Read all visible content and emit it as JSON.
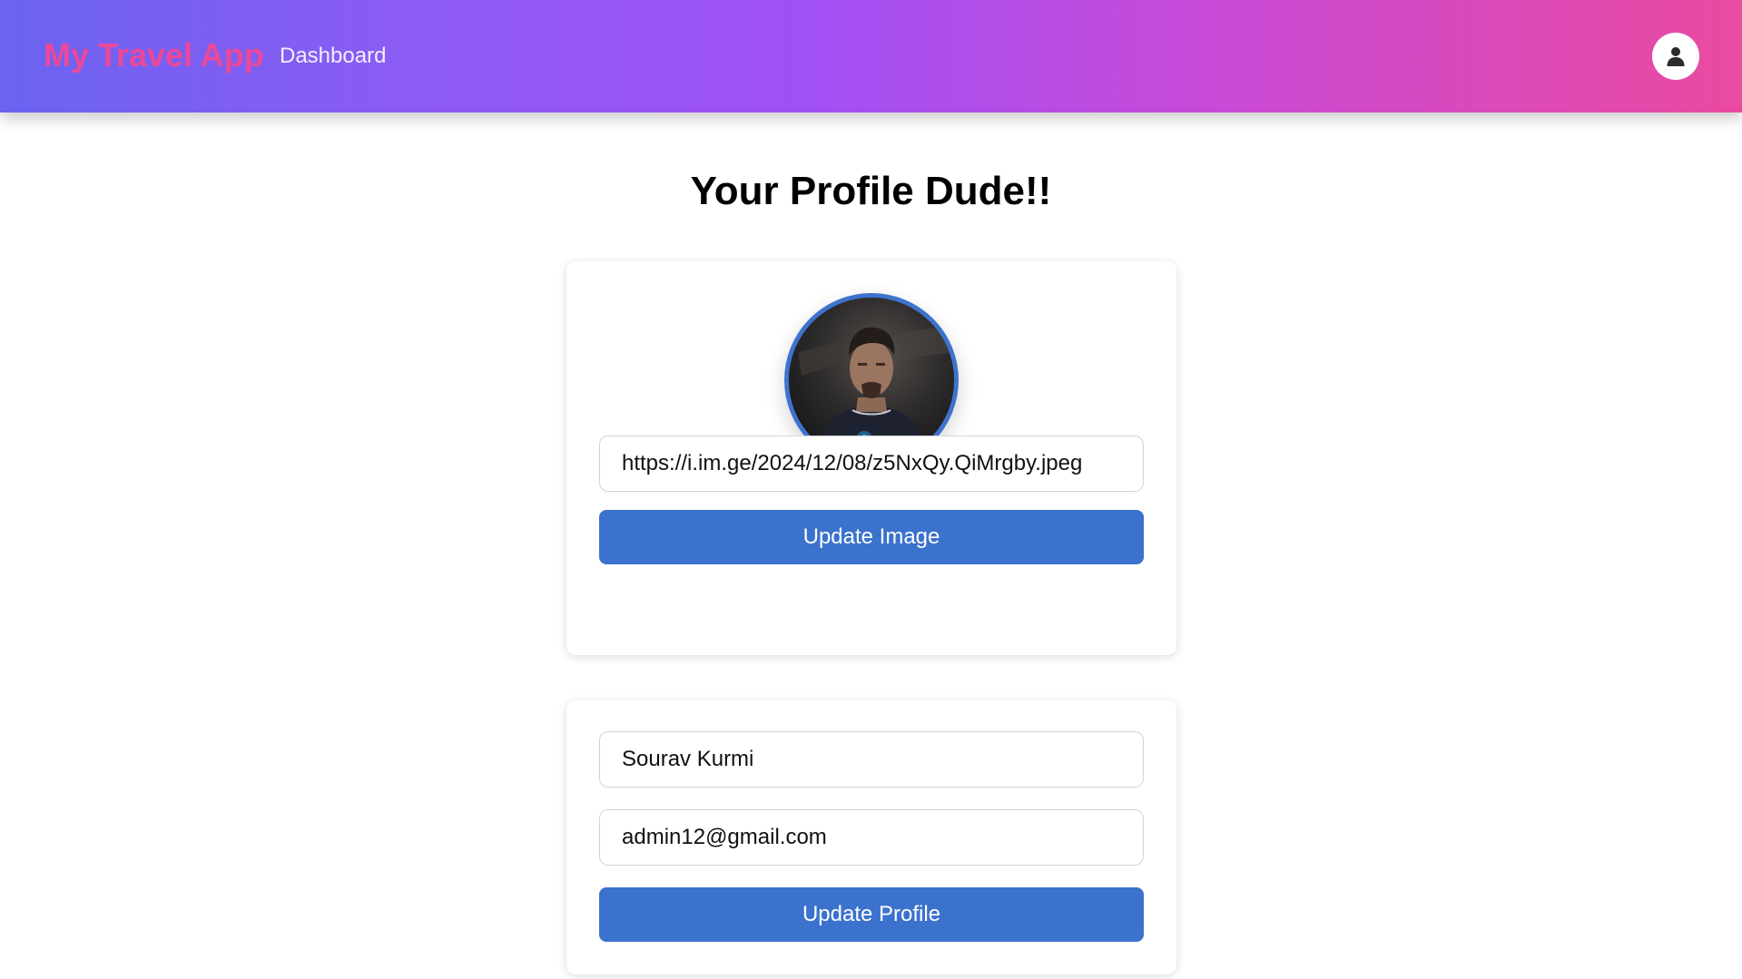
{
  "navbar": {
    "brand": "My Travel App",
    "links": [
      {
        "label": "Dashboard"
      }
    ],
    "user_icon": "user-icon"
  },
  "page": {
    "title": "Your Profile Dude!!"
  },
  "image_card": {
    "photo_alt": "profile photo",
    "url_value": "https://i.im.ge/2024/12/08/z5NxQy.QiMrgby.jpeg",
    "update_button": "Update Image"
  },
  "profile_card": {
    "name_value": "Sourav Kurmi",
    "email_value": "admin12@gmail.com",
    "update_button": "Update Profile"
  },
  "colors": {
    "brand": "#ec4899",
    "accent": "#3b72cd",
    "header_gradient": [
      "#6b63f1",
      "#a050f5",
      "#ea4aa0"
    ]
  }
}
